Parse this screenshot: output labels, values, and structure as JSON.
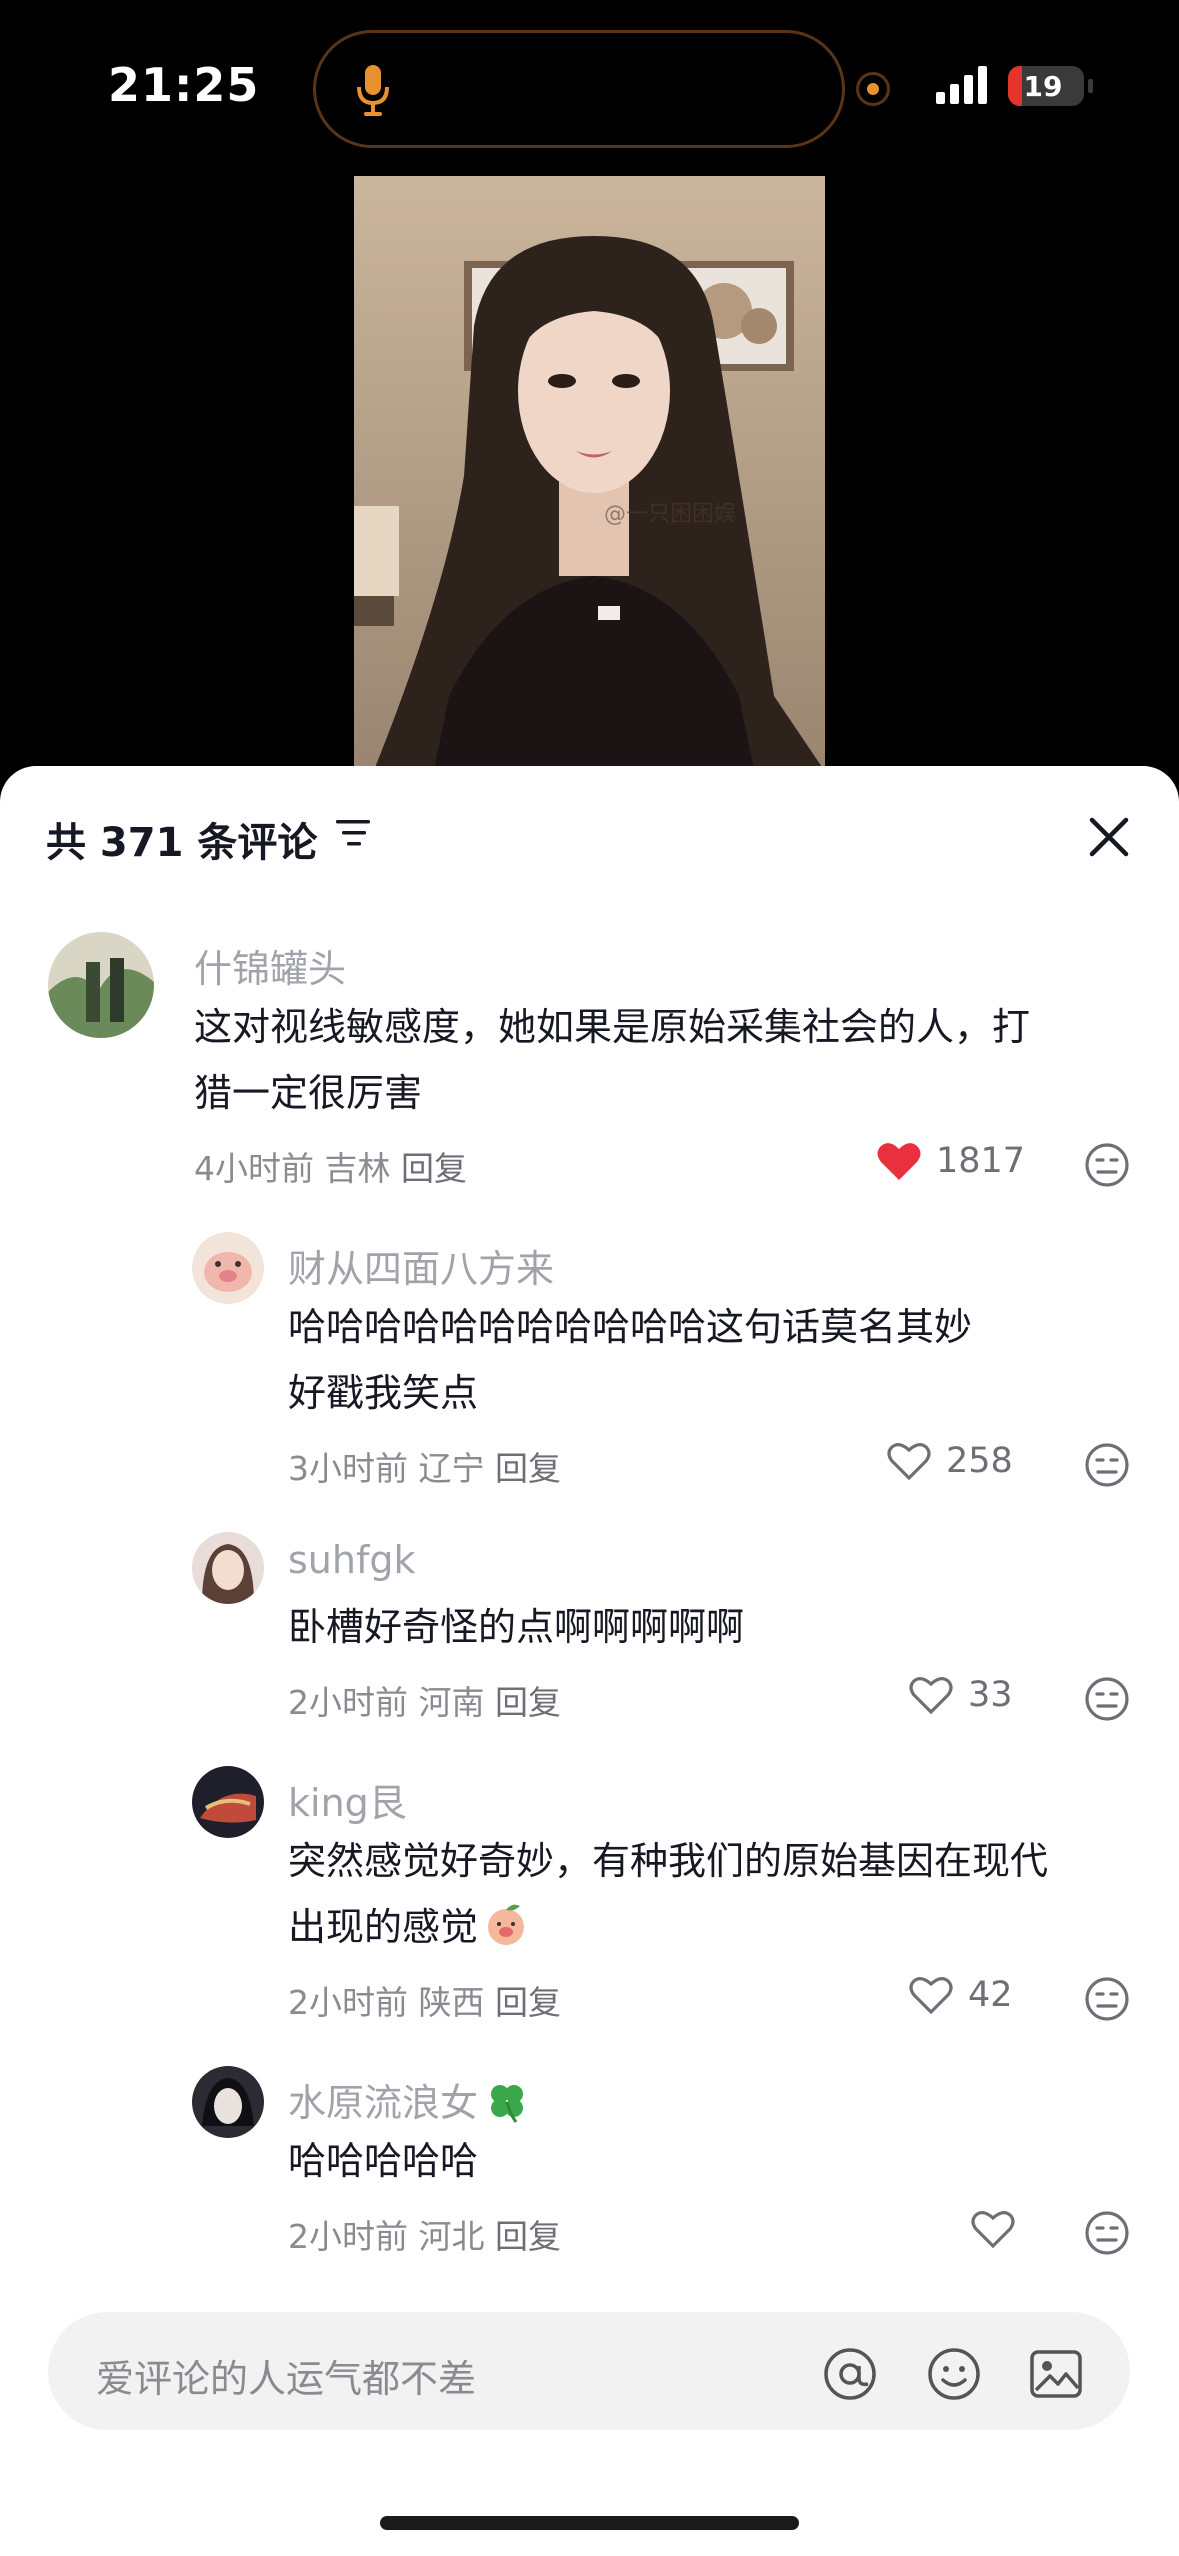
{
  "status_bar": {
    "time": "21:25",
    "battery": "19",
    "battery_level": 0.19
  },
  "video": {
    "watermark": "@一只困困娱"
  },
  "sheet": {
    "header": "共 371 条评论"
  },
  "comments": [
    {
      "user": "什锦罐头",
      "line1": "这对视线敏感度，她如果是原始采集社会的人，打",
      "line2": "猎一定很厉害",
      "time": "4小时前",
      "region": "吉林",
      "reply": "回复",
      "likes": "1817",
      "liked": true
    },
    {
      "user": "财从四面八方来",
      "line1": "哈哈哈哈哈哈哈哈哈哈哈这句话莫名其妙",
      "line2": "好戳我笑点",
      "time": "3小时前",
      "region": "辽宁",
      "reply": "回复",
      "likes": "258",
      "liked": false
    },
    {
      "user": "suhfgk",
      "line1": "卧槽好奇怪的点啊啊啊啊啊",
      "time": "2小时前",
      "region": "河南",
      "reply": "回复",
      "likes": "33",
      "liked": false
    },
    {
      "user": "king艮",
      "line1": "突然感觉好奇妙，有种我们的原始基因在现代",
      "line2": "出现的感觉",
      "time": "2小时前",
      "region": "陕西",
      "reply": "回复",
      "likes": "42",
      "liked": false
    },
    {
      "user": "水原流浪女",
      "line1": "哈哈哈哈哈",
      "time": "2小时前",
      "region": "河北",
      "reply": "回复",
      "likes": "",
      "liked": false
    }
  ],
  "input": {
    "placeholder": "爱评论的人运气都不差"
  },
  "colors": {
    "like_red": "#fe2c55",
    "text": "#161823",
    "muted": "#a1a3ab",
    "accent_orange": "#e8912f"
  }
}
